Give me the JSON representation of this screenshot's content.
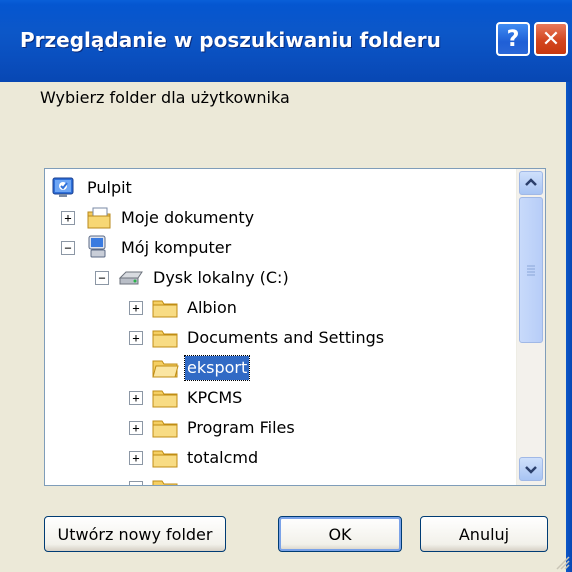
{
  "dialog": {
    "title": "Przeglądanie w poszukiwaniu folderu",
    "help_glyph": "?",
    "close_glyph": "✕",
    "prompt": "Wybierz folder dla użytkownika"
  },
  "tree": {
    "items": [
      {
        "label": "Pulpit",
        "icon": "desktop-icon",
        "expander": ""
      },
      {
        "label": "Moje dokumenty",
        "icon": "my-documents-icon",
        "expander": "+"
      },
      {
        "label": "Mój komputer",
        "icon": "my-computer-icon",
        "expander": "−"
      },
      {
        "label": "Dysk lokalny (C:)",
        "icon": "local-disk-icon",
        "expander": "−"
      },
      {
        "label": "Albion",
        "icon": "folder-icon",
        "expander": "+"
      },
      {
        "label": "Documents and Settings",
        "icon": "folder-icon",
        "expander": "+"
      },
      {
        "label": "eksport",
        "icon": "folder-icon",
        "expander": "",
        "selected": true
      },
      {
        "label": "KPCMS",
        "icon": "folder-icon",
        "expander": "+"
      },
      {
        "label": "Program Files",
        "icon": "folder-icon",
        "expander": "+"
      },
      {
        "label": "totalcmd",
        "icon": "folder-icon",
        "expander": "+"
      }
    ]
  },
  "buttons": {
    "new_folder": "Utwórz nowy folder",
    "ok": "OK",
    "cancel": "Anuluj"
  },
  "colors": {
    "titlebar": "#0a4fbf",
    "selection": "#316ac5",
    "face": "#ece9d8"
  }
}
